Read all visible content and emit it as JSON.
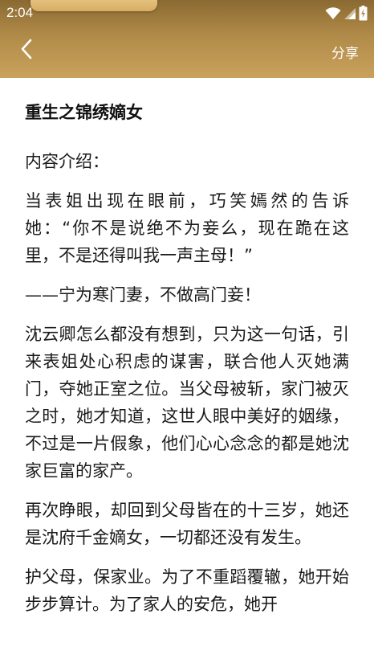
{
  "status_bar": {
    "time": "2:04"
  },
  "nav": {
    "back_icon": "chevron-left-icon",
    "share_label": "分享"
  },
  "colors": {
    "header_top": "#8a6a32",
    "header_bottom": "#c9a25c",
    "text": "#1a1a1a",
    "background": "#ffffff"
  },
  "book": {
    "title": "重生之锦绣嫡女",
    "intro_label": "内容介绍：",
    "paragraphs": [
      "当表姐出现在眼前，巧笑嫣然的告诉她：“你不是说绝不为妾么，现在跪在这里，不是还得叫我一声主母！”",
      "——宁为寒门妻，不做高门妾！",
      "沈云卿怎么都没有想到，只为这一句话，引来表姐处心积虑的谋害，联合他人灭她满门，夺她正室之位。当父母被斩，家门被灭之时，她才知道，这世人眼中美好的姻缘，不过是一片假象，他们心心念念的都是她沈家巨富的家产。",
      "再次睁眼，却回到父母皆在的十三岁，她还是沈府千金嫡女，一切都还没有发生。",
      "护父母，保家业。为了不重蹈覆辙，她开始步步算计。为了家人的安危，她开"
    ]
  }
}
